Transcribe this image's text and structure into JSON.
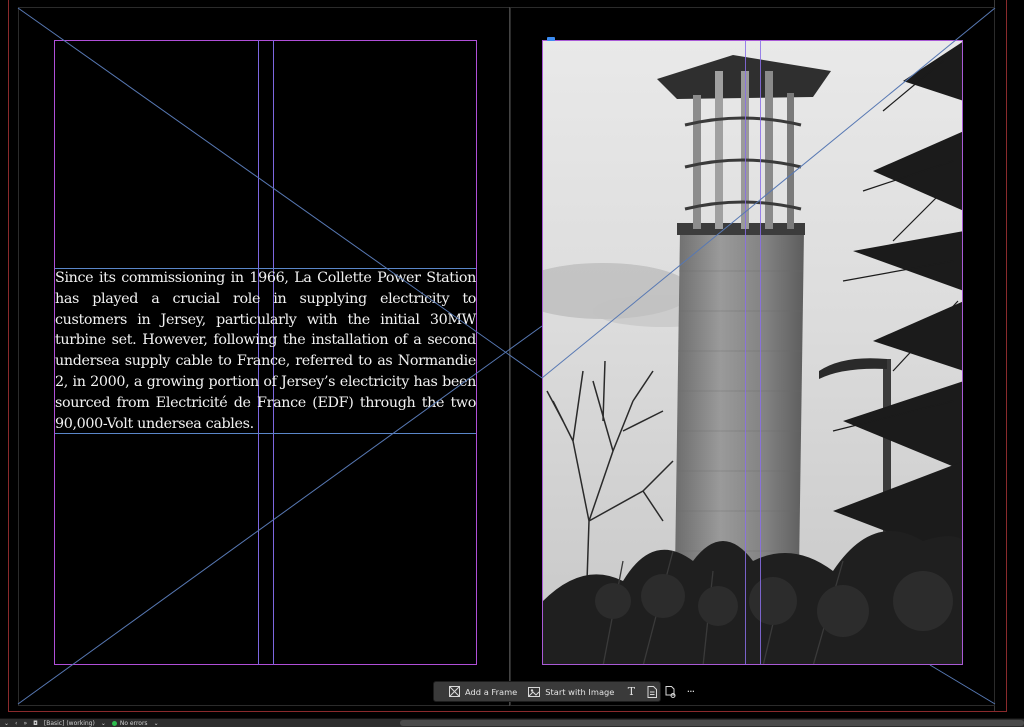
{
  "document": {
    "body_text": " Since its commissioning in 1966, La Collette Power Station has played a crucial role in supplying electricity to customers in Jersey, particularly with the initial 30MW turbine set. However, following the installation of a second undersea supply cable to France, referred to as Normandie 2, in 2000, a growing portion of Jersey’s electricity has been sourced from Electricité de France (EDF) through the two 90,000-Volt undersea cables.",
    "image_subject": "tower-photo"
  },
  "context_toolbar": {
    "add_frame_label": "Add a Frame",
    "start_with_image_label": "Start with Image",
    "icons": [
      "frame-icon",
      "image-icon",
      "type-icon",
      "page-icon",
      "copy-icon",
      "more-icon"
    ]
  },
  "status_bar": {
    "workspace": "[Basic] (working)",
    "preflight": "No errors"
  },
  "colors": {
    "pasteboard": "#000000",
    "margin_guide": "#b04fd8",
    "column_guide": "#7c67e0",
    "frame_edge": "#5a86c9",
    "bleed_guide": "#c8383b",
    "status_ok": "#2dbd4e"
  }
}
